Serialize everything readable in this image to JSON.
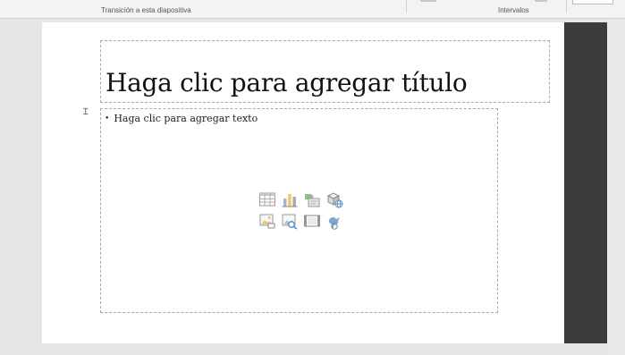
{
  "ribbon": {
    "transition_group_label": "Transición a esta diapositiva",
    "timing_group_label": "Intervalos"
  },
  "slide": {
    "title_placeholder": "Haga clic para agregar título",
    "body_placeholder": "Haga clic para agregar texto",
    "content_icons": [
      "insert-table-icon",
      "insert-chart-icon",
      "insert-smartart-icon",
      "insert-3d-model-icon",
      "insert-picture-icon",
      "insert-online-picture-icon",
      "insert-video-icon",
      "insert-icons-icon"
    ]
  },
  "colors": {
    "slide_background": "#ffffff",
    "workspace_background": "#e6e6e6",
    "side_panel": "#3c3c3c",
    "placeholder_border": "#a8a8a8"
  }
}
